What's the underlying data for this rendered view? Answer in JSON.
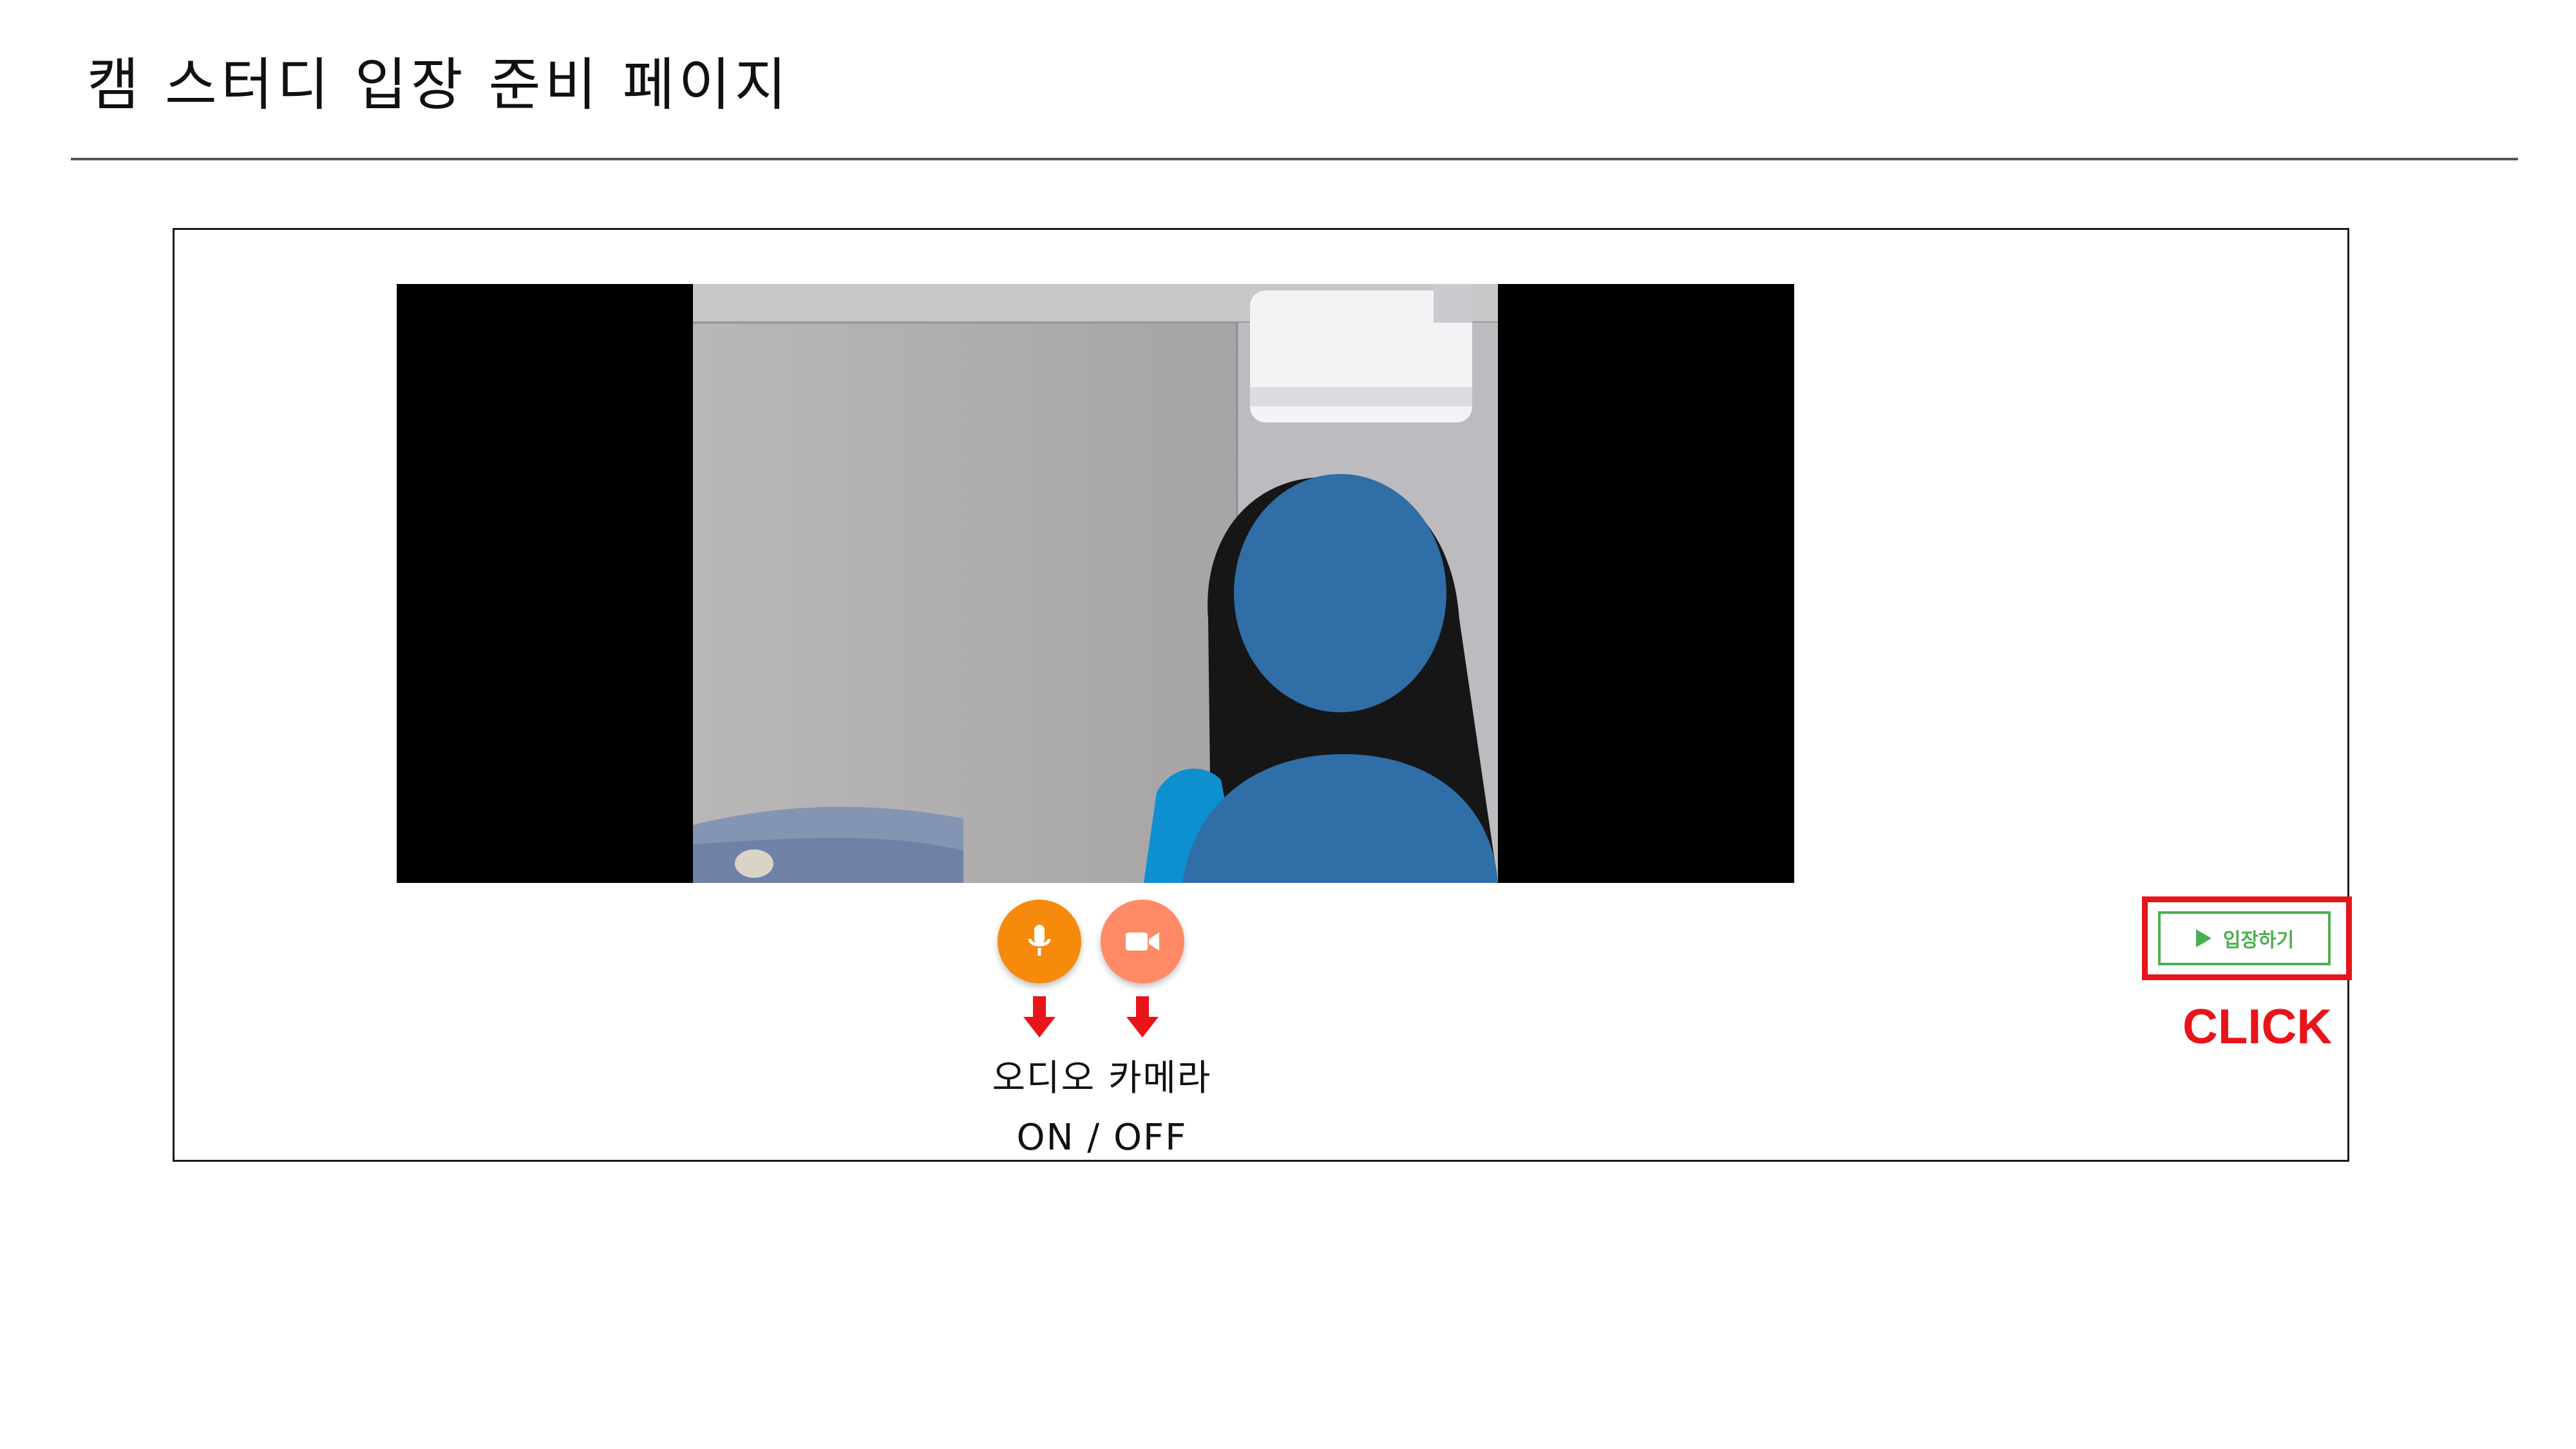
{
  "page": {
    "title": "캠 스터디 입장 준비 페이지"
  },
  "video": {
    "face_placeholder_icon": "person-silhouette-icon"
  },
  "controls": {
    "mic_icon": "microphone-icon",
    "camera_icon": "video-camera-icon",
    "mic_color": "#f58a0b",
    "camera_color": "#ff8a65",
    "annotation_line1": "오디오  카메라",
    "annotation_line2": "ON / OFF"
  },
  "enter": {
    "label": "입장하기",
    "icon": "play-icon",
    "accent_color": "#4caf50"
  },
  "annotation": {
    "click_label": "CLICK",
    "highlight_color": "#e8141a"
  }
}
